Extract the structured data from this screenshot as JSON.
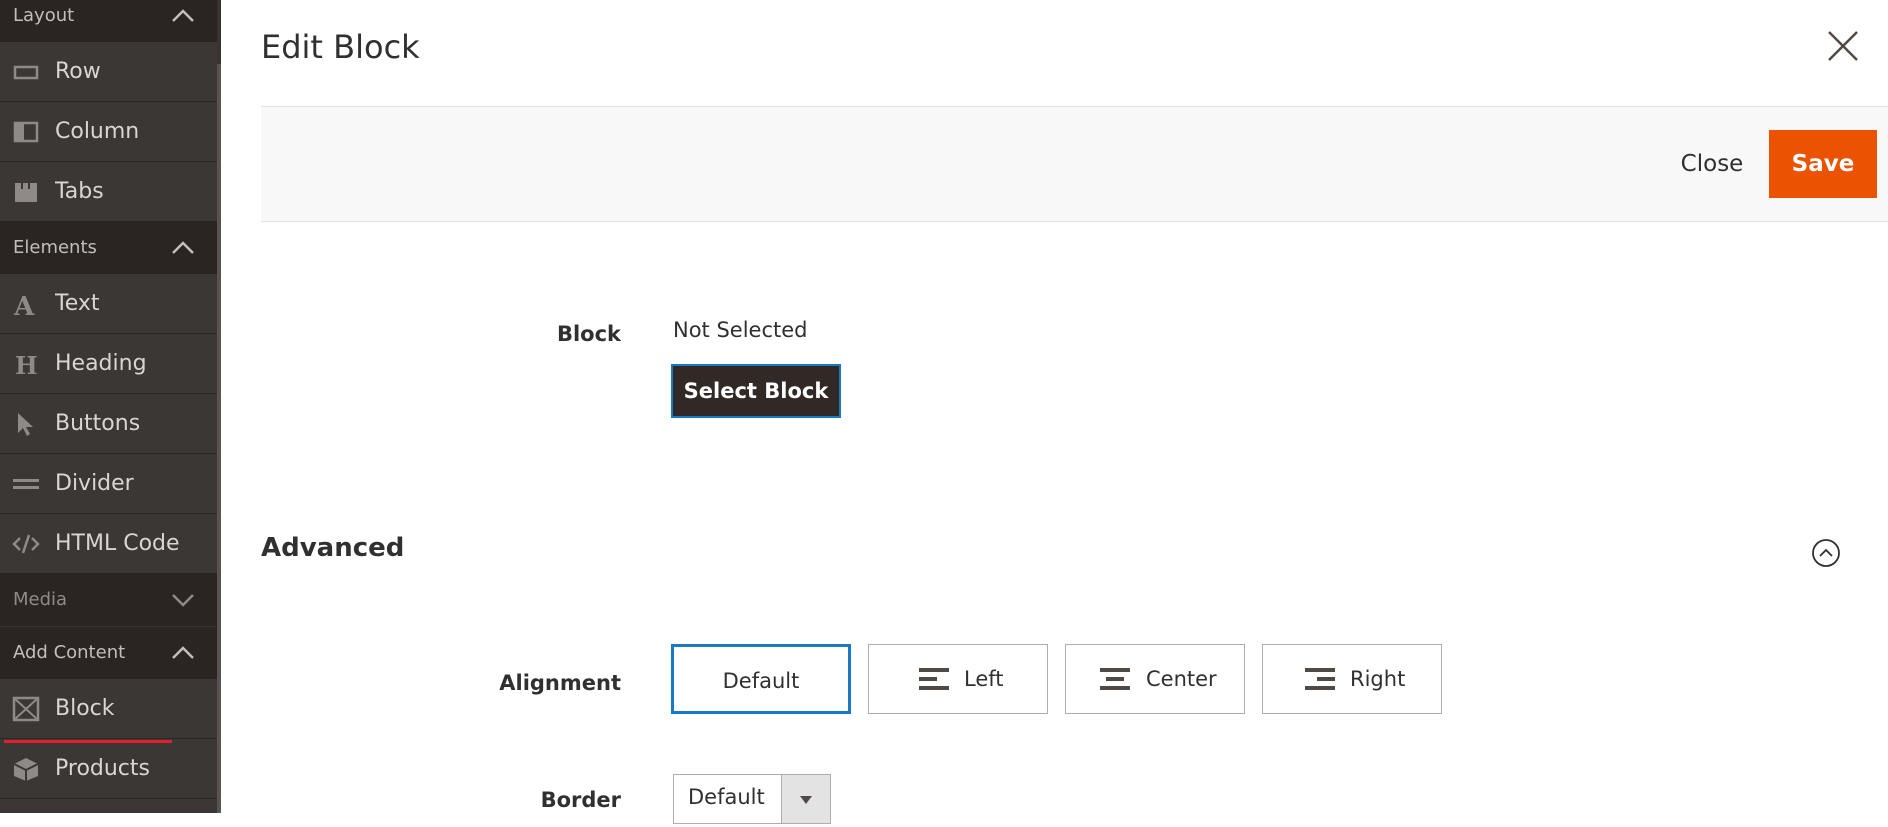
{
  "sidebar": {
    "sections": [
      {
        "title": "Layout",
        "expanded": true
      },
      {
        "title": "Elements",
        "expanded": true
      },
      {
        "title": "Media",
        "expanded": false
      },
      {
        "title": "Add Content",
        "expanded": true
      }
    ],
    "layout_items": [
      {
        "label": "Row",
        "icon": "row-icon"
      },
      {
        "label": "Column",
        "icon": "column-icon"
      },
      {
        "label": "Tabs",
        "icon": "tabs-icon"
      }
    ],
    "element_items": [
      {
        "label": "Text",
        "icon": "text-icon"
      },
      {
        "label": "Heading",
        "icon": "heading-icon"
      },
      {
        "label": "Buttons",
        "icon": "cursor-icon"
      },
      {
        "label": "Divider",
        "icon": "divider-icon"
      },
      {
        "label": "HTML Code",
        "icon": "code-icon"
      }
    ],
    "content_items": [
      {
        "label": "Block",
        "icon": "block-icon"
      },
      {
        "label": "Products",
        "icon": "products-icon"
      }
    ]
  },
  "modal": {
    "title": "Edit Block",
    "close_label": "Close",
    "save_label": "Save",
    "block": {
      "label": "Block",
      "value": "Not Selected",
      "button_label": "Select Block"
    },
    "advanced": {
      "title": "Advanced",
      "alignment": {
        "label": "Alignment",
        "options": [
          "Default",
          "Left",
          "Center",
          "Right"
        ],
        "selected": "Default"
      },
      "border": {
        "label": "Border",
        "value": "Default"
      }
    }
  },
  "colors": {
    "sidebar_bg": "#373330",
    "section_header_bg": "#2a2522",
    "save_orange": "#eb5202",
    "focus_blue": "#1979c3",
    "select_block_bg": "#302925",
    "annotation_red": "#e0202a"
  }
}
